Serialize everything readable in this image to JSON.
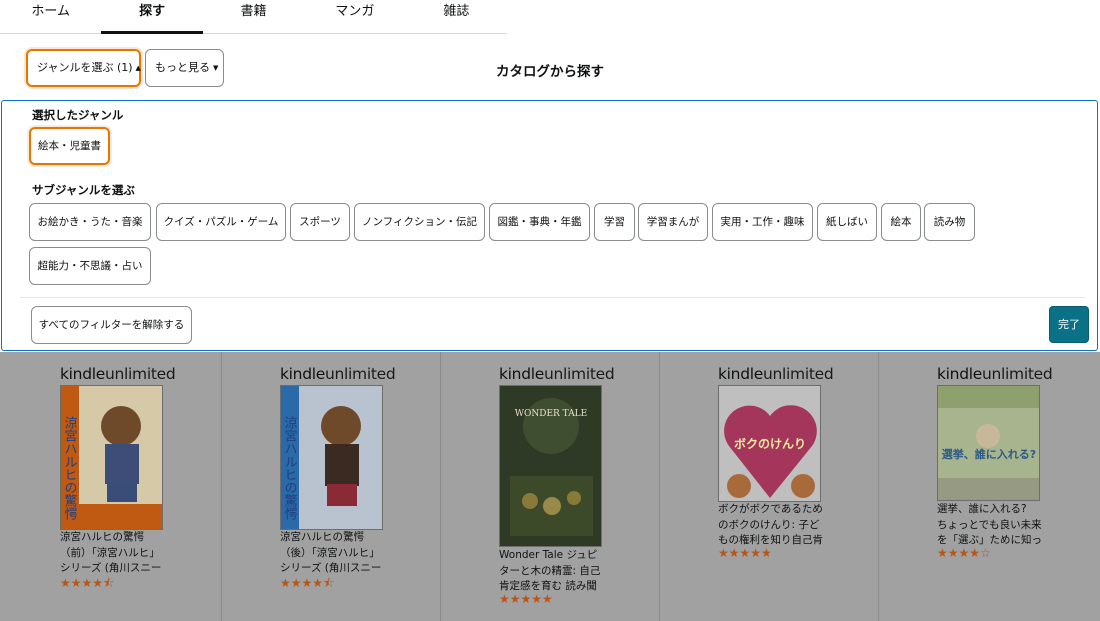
{
  "nav": {
    "tabs": [
      {
        "label": "ホーム"
      },
      {
        "label": "探す"
      },
      {
        "label": "書籍"
      },
      {
        "label": "マンガ"
      },
      {
        "label": "雑誌"
      }
    ],
    "active_index": 1
  },
  "filters": {
    "genre_button": "ジャンルを選ぶ (1)",
    "more_button": "もっと見る",
    "catalog_title": "カタログから探す"
  },
  "panel": {
    "selected_label": "選択したジャンル",
    "selected_genre": "絵本・児童書",
    "subgenre_label": "サブジャンルを選ぶ",
    "subgenres": [
      "お絵かき・うた・音楽",
      "クイズ・パズル・ゲーム",
      "スポーツ",
      "ノンフィクション・伝記",
      "図鑑・事典・年鑑",
      "学習",
      "学習まんが",
      "実用・工作・趣味",
      "紙しばい",
      "絵本",
      "読み物",
      "超能力・不思議・占い"
    ],
    "clear_button": "すべてのフィルターを解除する",
    "done_button": "完了"
  },
  "colors": {
    "accent_orange": "#e77600",
    "panel_border": "#0b70c0",
    "done_button": "#0a7187",
    "star": "#b5561a"
  },
  "results": {
    "badge_kindle": "kindle",
    "badge_unlimited": "unlimited",
    "books": [
      {
        "title_lines": [
          "涼宮ハルヒの驚愕",
          "（前）「涼宮ハルヒ」",
          "シリーズ (角川スニー"
        ],
        "rating": 4.5,
        "cover_text": "涼宮ハルヒの驚愕"
      },
      {
        "title_lines": [
          "涼宮ハルヒの驚愕",
          "（後）「涼宮ハルヒ」",
          "シリーズ (角川スニー"
        ],
        "rating": 4.5,
        "cover_text": "涼宮ハルヒの驚愕"
      },
      {
        "title_lines": [
          "Wonder Tale ジュピ",
          "ターと木の精霊: 自己",
          "肯定感を育む 読み聞"
        ],
        "rating": 5,
        "cover_text": "WONDER TALE"
      },
      {
        "title_lines": [
          "ボクがボクであるため",
          "のボクのけんり: 子ど",
          "もの権利を知り自己肯"
        ],
        "rating": 5,
        "cover_text": "ボクのけんり"
      },
      {
        "title_lines": [
          "選挙、誰に入れる?",
          "ちょっとでも良い未来",
          "を「選ぶ」ために知っ"
        ],
        "rating": 4,
        "cover_text": "選挙、誰に入れる?"
      }
    ]
  }
}
